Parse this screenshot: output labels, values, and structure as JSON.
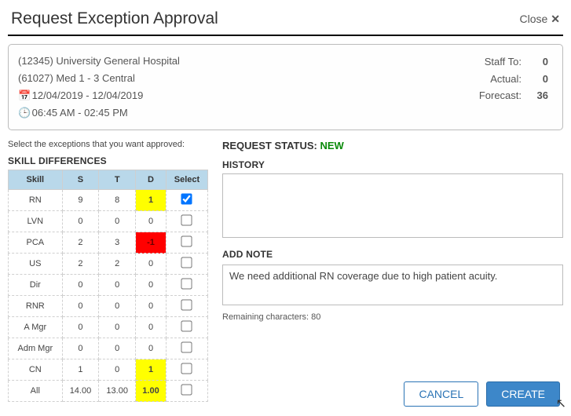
{
  "dialog": {
    "title": "Request Exception Approval",
    "close": "Close"
  },
  "info": {
    "facility": "(12345) University General Hospital",
    "unit": "(61027) Med 1 - 3 Central",
    "dateRange": "12/04/2019 - 12/04/2019",
    "timeRange": "06:45 AM - 02:45 PM",
    "stats": {
      "staffToLabel": "Staff To:",
      "staffTo": "0",
      "actualLabel": "Actual:",
      "actual": "0",
      "forecastLabel": "Forecast:",
      "forecast": "36"
    }
  },
  "left": {
    "instruction": "Select the exceptions that you want approved:",
    "heading": "SKILL DIFFERENCES",
    "cols": {
      "skill": "Skill",
      "s": "S",
      "t": "T",
      "d": "D",
      "select": "Select"
    },
    "rows": [
      {
        "skill": "RN",
        "s": "9",
        "t": "8",
        "d": "1",
        "dClass": "d-yellow",
        "checked": true
      },
      {
        "skill": "LVN",
        "s": "0",
        "t": "0",
        "d": "0",
        "dClass": "",
        "checked": false
      },
      {
        "skill": "PCA",
        "s": "2",
        "t": "3",
        "d": "-1",
        "dClass": "d-red",
        "checked": false
      },
      {
        "skill": "US",
        "s": "2",
        "t": "2",
        "d": "0",
        "dClass": "",
        "checked": false
      },
      {
        "skill": "Dir",
        "s": "0",
        "t": "0",
        "d": "0",
        "dClass": "",
        "checked": false
      },
      {
        "skill": "RNR",
        "s": "0",
        "t": "0",
        "d": "0",
        "dClass": "",
        "checked": false
      },
      {
        "skill": "A Mgr",
        "s": "0",
        "t": "0",
        "d": "0",
        "dClass": "",
        "checked": false
      },
      {
        "skill": "Adm Mgr",
        "s": "0",
        "t": "0",
        "d": "0",
        "dClass": "",
        "checked": false
      },
      {
        "skill": "CN",
        "s": "1",
        "t": "0",
        "d": "1",
        "dClass": "d-yellow",
        "checked": false
      },
      {
        "skill": "All",
        "s": "14.00",
        "t": "13.00",
        "d": "1.00",
        "dClass": "d-yellow",
        "checked": false
      }
    ]
  },
  "right": {
    "statusLabel": "REQUEST STATUS: ",
    "statusValue": "NEW",
    "historyLabel": "HISTORY",
    "addNoteLabel": "ADD NOTE",
    "noteText": "We need additional RN coverage due to high patient acuity.",
    "remainingPrefix": "Remaining characters: ",
    "remaining": "80"
  },
  "buttons": {
    "cancel": "CANCEL",
    "create": "CREATE"
  }
}
